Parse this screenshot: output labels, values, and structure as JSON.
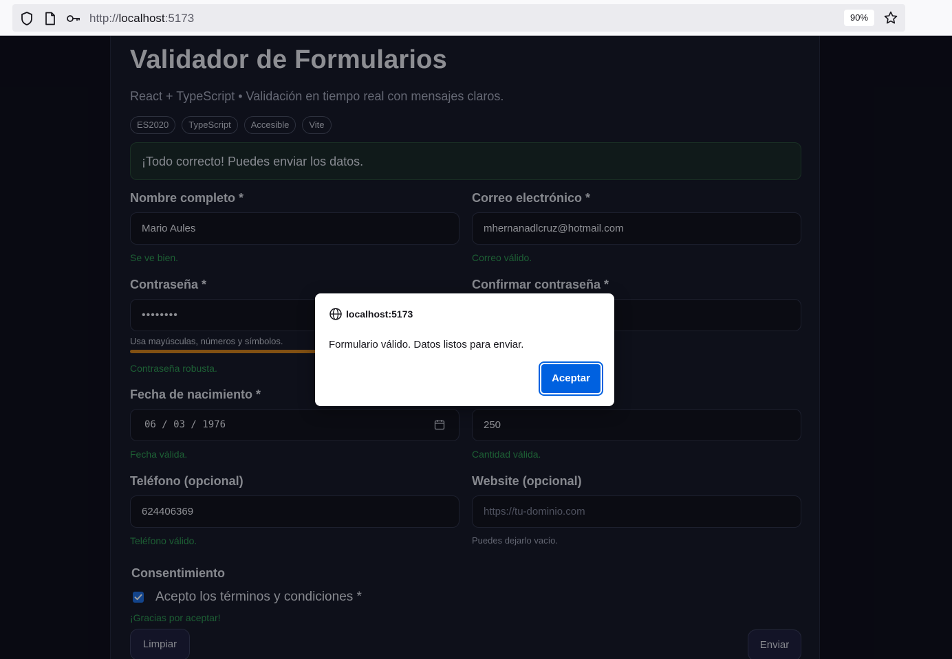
{
  "browser": {
    "url_scheme": "http://",
    "url_host": "localhost",
    "url_port": ":5173",
    "zoom": "90%"
  },
  "page": {
    "title": "Validador de Formularios",
    "subtitle": "React + TypeScript • Validación en tiempo real con mensajes claros.",
    "tags": [
      "ES2020",
      "TypeScript",
      "Accesible",
      "Vite"
    ],
    "alert": "¡Todo correcto! Puedes enviar los datos."
  },
  "form": {
    "name": {
      "label": "Nombre completo *",
      "value": "Mario Aules",
      "help": "Se ve bien."
    },
    "email": {
      "label": "Correo electrónico *",
      "value": "mhernanadlcruz@hotmail.com",
      "help": "Correo válido."
    },
    "password": {
      "label": "Contraseña *",
      "value": "••••••••",
      "hint": "Usa mayúsculas, números y símbolos.",
      "strength": 1.0,
      "help": "Contraseña robusta."
    },
    "confirm": {
      "label": "Confirmar contraseña *",
      "value": ""
    },
    "birth": {
      "label": "Fecha de nacimiento *",
      "value": "06 / 03 / 1976",
      "help": "Fecha válida."
    },
    "amount": {
      "value": "250",
      "help": "Cantidad válida."
    },
    "phone": {
      "label": "Teléfono (opcional)",
      "value": "624406369",
      "help": "Teléfono válido."
    },
    "website": {
      "label": "Website (opcional)",
      "placeholder": "https://tu-dominio.com",
      "help": "Puedes dejarlo vacío."
    },
    "consent": {
      "title": "Consentimiento",
      "label": "Acepto los términos y condiciones *",
      "checked": true,
      "help": "¡Gracias por aceptar!"
    },
    "clear_label": "Limpiar",
    "submit_label": "Enviar"
  },
  "dialog": {
    "origin": "localhost:5173",
    "message": "Formulario válido. Datos listos para enviar.",
    "accept_label": "Aceptar"
  },
  "colors": {
    "accent": "#0061e0",
    "success": "#2f9a55",
    "strength": "#d0821e",
    "background": "#0f101d"
  }
}
